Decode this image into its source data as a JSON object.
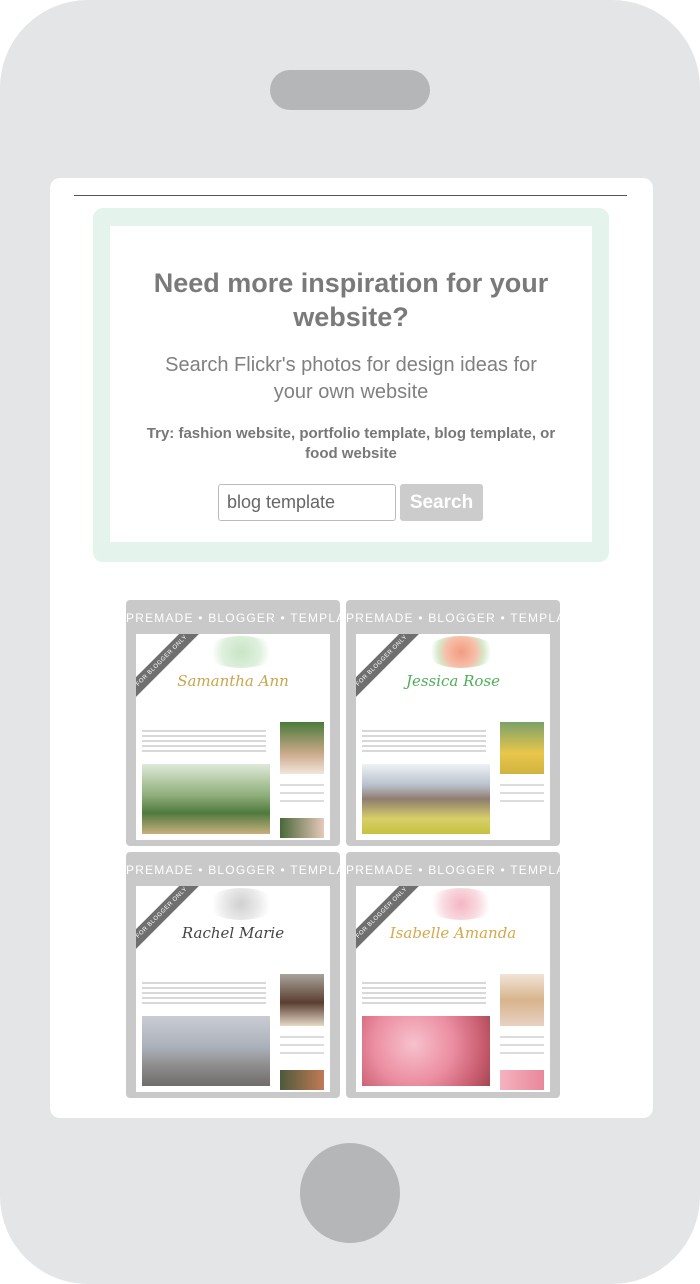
{
  "inspiration": {
    "title": "Need more inspiration for your website?",
    "subtitle": "Search Flickr's photos for design ideas for your own website",
    "try_text": "Try: fashion website, portfolio template, blog template, or food website",
    "search_value": "blog template",
    "search_button": "Search"
  },
  "templates": [
    {
      "header": "PREMADE • BLOGGER • TEMPLATE",
      "ribbon": "FOR BLOGGER ONLY",
      "name": "Samantha Ann",
      "accent": "#c9a64a"
    },
    {
      "header": "PREMADE • BLOGGER • TEMPLATE",
      "ribbon": "FOR BLOGGER ONLY",
      "name": "Jessica Rose",
      "accent": "#4fae5b"
    },
    {
      "header": "PREMADE • BLOGGER • TEMPLATE",
      "ribbon": "FOR BLOGGER ONLY",
      "name": "Rachel Marie",
      "accent": "#444444"
    },
    {
      "header": "PREMADE • BLOGGER • TEMPLATE",
      "ribbon": "FOR BLOGGER ONLY",
      "name": "Isabelle Amanda",
      "accent": "#d6a84a"
    }
  ],
  "colors": {
    "phone_body": "#e3e5e6",
    "box_border": "#e4f3ec",
    "card_frame": "#c9c9c9"
  }
}
